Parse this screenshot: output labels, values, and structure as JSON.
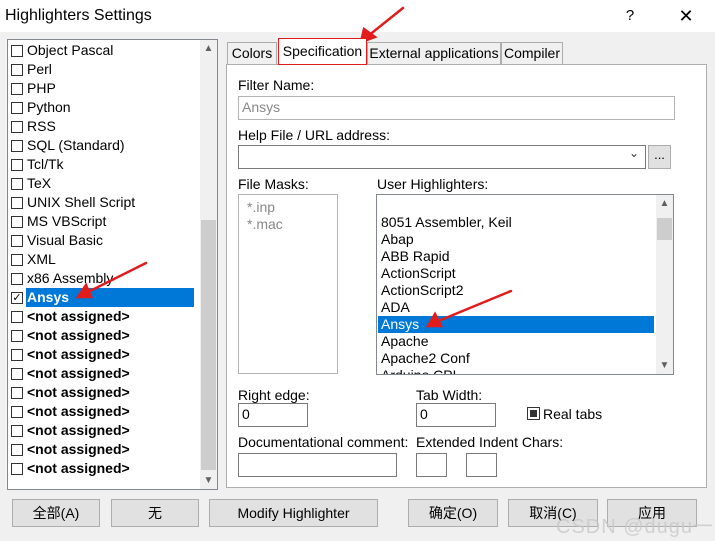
{
  "window": {
    "title": "Highlighters Settings",
    "help": "?",
    "close": "✕"
  },
  "left_list": {
    "items": [
      {
        "label": "Object Pascal",
        "checked": false
      },
      {
        "label": "Perl",
        "checked": false
      },
      {
        "label": "PHP",
        "checked": false
      },
      {
        "label": "Python",
        "checked": false
      },
      {
        "label": "RSS",
        "checked": false
      },
      {
        "label": "SQL (Standard)",
        "checked": false
      },
      {
        "label": "Tcl/Tk",
        "checked": false
      },
      {
        "label": "TeX",
        "checked": false
      },
      {
        "label": "UNIX Shell Script",
        "checked": false
      },
      {
        "label": "MS VBScript",
        "checked": false
      },
      {
        "label": "Visual Basic",
        "checked": false
      },
      {
        "label": "XML",
        "checked": false
      },
      {
        "label": "x86 Assembly",
        "checked": false
      },
      {
        "label": "Ansys",
        "checked": true
      },
      {
        "label": "<not assigned>",
        "checked": false
      },
      {
        "label": "<not assigned>",
        "checked": false
      },
      {
        "label": "<not assigned>",
        "checked": false
      },
      {
        "label": "<not assigned>",
        "checked": false
      },
      {
        "label": "<not assigned>",
        "checked": false
      },
      {
        "label": "<not assigned>",
        "checked": false
      },
      {
        "label": "<not assigned>",
        "checked": false
      },
      {
        "label": "<not assigned>",
        "checked": false
      },
      {
        "label": "<not assigned>",
        "checked": false
      }
    ],
    "check_mark": "✓",
    "scroll_up": "▲",
    "scroll_down": "▼"
  },
  "tabs": [
    {
      "label": "Colors"
    },
    {
      "label": "Specification"
    },
    {
      "label": "External applications"
    },
    {
      "label": "Compiler"
    }
  ],
  "spec": {
    "filter_name_label": "Filter Name:",
    "filter_name_value": "Ansys",
    "help_file_label": "Help File / URL address:",
    "help_file_value": "",
    "dropdown_glyph": "⌄",
    "browse_label": "...",
    "file_masks_label": "File Masks:",
    "file_masks": [
      "*.inp",
      "*.mac"
    ],
    "user_highlighters_label": "User Highlighters:",
    "user_highlighters": [
      "8051 Assembler, Keil",
      "Abap",
      "ABB Rapid",
      "ActionScript",
      "ActionScript2",
      "ADA",
      "Ansys",
      "Apache",
      "Apache2 Conf",
      "Arduino CPL"
    ],
    "selected_highlighter": "Ansys",
    "right_edge_label": "Right edge:",
    "right_edge_value": "0",
    "tab_width_label": "Tab Width:",
    "tab_width_value": "0",
    "real_tabs_label": "Real tabs",
    "doc_comment_label": "Documentational comment:",
    "doc_comment_value": "",
    "ext_indent_label": "Extended Indent Chars:",
    "ext_indent_1": "",
    "ext_indent_2": ""
  },
  "buttons": {
    "all": "全部(A)",
    "none": "无",
    "modify": "Modify Highlighter",
    "ok": "确定(O)",
    "cancel": "取消(C)",
    "apply": "应用"
  },
  "watermark": "CSDN @dugu一下",
  "colors": {
    "selection": "#0078d7",
    "annotation_arrow": "#e21b1b"
  }
}
